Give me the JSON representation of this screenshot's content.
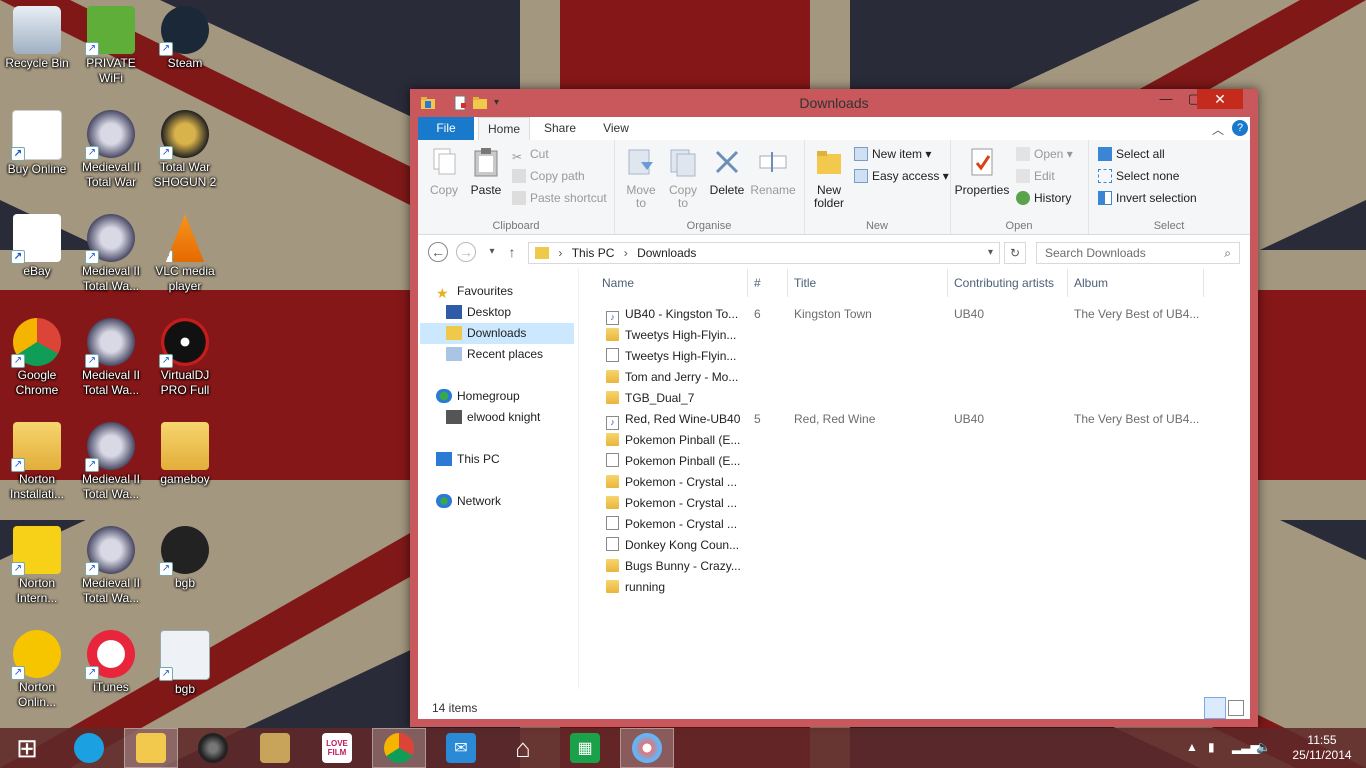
{
  "desktop": {
    "icons": [
      {
        "label": "Recycle Bin",
        "icon": "recycle-bin-icon"
      },
      {
        "label": "PRIVATE WiFi",
        "icon": "private-wifi-icon"
      },
      {
        "label": "Steam",
        "icon": "steam-icon"
      },
      {
        "label": "Buy Online",
        "icon": "acer-icon"
      },
      {
        "label": "Medieval II Total War",
        "icon": "medieval-helmet-icon"
      },
      {
        "label": "Total War SHOGUN 2",
        "icon": "shogun-helmet-icon"
      },
      {
        "label": "eBay",
        "icon": "ebay-icon"
      },
      {
        "label": "Medieval II Total Wa...",
        "icon": "medieval-helmet-icon"
      },
      {
        "label": "VLC media player",
        "icon": "vlc-cone-icon"
      },
      {
        "label": "Google Chrome",
        "icon": "chrome-icon"
      },
      {
        "label": "Medieval II Total Wa...",
        "icon": "medieval-helmet-icon"
      },
      {
        "label": "VirtualDJ PRO Full",
        "icon": "virtualdj-icon"
      },
      {
        "label": "Norton Installati...",
        "icon": "folder-icon"
      },
      {
        "label": "Medieval II Total Wa...",
        "icon": "medieval-helmet-icon"
      },
      {
        "label": "gameboy",
        "icon": "folder-icon"
      },
      {
        "label": "Norton Intern...",
        "icon": "norton-internet-icon"
      },
      {
        "label": "Medieval II Total Wa...",
        "icon": "medieval-helmet-icon"
      },
      {
        "label": "bgb",
        "icon": "gamepad-icon"
      },
      {
        "label": "Norton Onlin...",
        "icon": "norton-online-icon"
      },
      {
        "label": "iTunes",
        "icon": "itunes-icon"
      },
      {
        "label": "bgb",
        "icon": "config-file-icon"
      }
    ]
  },
  "window": {
    "title": "Downloads",
    "tabs": {
      "file": "File",
      "home": "Home",
      "share": "Share",
      "view": "View"
    },
    "ribbon": {
      "clipboard": {
        "name": "Clipboard",
        "copy": "Copy",
        "paste": "Paste",
        "cut": "Cut",
        "copy_path": "Copy path",
        "paste_shortcut": "Paste shortcut"
      },
      "organise": {
        "name": "Organise",
        "move_to": "Move to",
        "copy_to": "Copy to",
        "delete": "Delete",
        "rename": "Rename"
      },
      "new": {
        "name": "New",
        "new_folder": "New folder",
        "new_item": "New item",
        "easy_access": "Easy access"
      },
      "open": {
        "name": "Open",
        "properties": "Properties",
        "open": "Open",
        "edit": "Edit",
        "history": "History"
      },
      "select": {
        "name": "Select",
        "select_all": "Select all",
        "select_none": "Select none",
        "invert_selection": "Invert selection"
      }
    },
    "address": {
      "crumbs": [
        "This PC",
        "Downloads"
      ],
      "search_placeholder": "Search Downloads"
    },
    "nav": {
      "favourites": "Favourites",
      "desktop": "Desktop",
      "downloads": "Downloads",
      "recent": "Recent places",
      "homegroup": "Homegroup",
      "user": "elwood knight",
      "this_pc": "This PC",
      "network": "Network"
    },
    "columns": {
      "name": "Name",
      "num": "#",
      "title": "Title",
      "artists": "Contributing artists",
      "album": "Album"
    },
    "files": [
      {
        "name": "UB40 - Kingston To...",
        "type": "music",
        "num": "6",
        "title": "Kingston Town",
        "artist": "UB40",
        "album": "The Very Best of UB4..."
      },
      {
        "name": "Tweetys High-Flyin...",
        "type": "folder",
        "num": "",
        "title": "",
        "artist": "",
        "album": ""
      },
      {
        "name": "Tweetys High-Flyin...",
        "type": "doc",
        "num": "",
        "title": "",
        "artist": "",
        "album": ""
      },
      {
        "name": "Tom and Jerry - Mo...",
        "type": "folder",
        "num": "",
        "title": "",
        "artist": "",
        "album": ""
      },
      {
        "name": "TGB_Dual_7",
        "type": "folder",
        "num": "",
        "title": "",
        "artist": "",
        "album": ""
      },
      {
        "name": "Red, Red Wine-UB40",
        "type": "music",
        "num": "5",
        "title": "Red, Red Wine",
        "artist": "UB40",
        "album": "The Very Best of UB4..."
      },
      {
        "name": "Pokemon Pinball (E...",
        "type": "folder",
        "num": "",
        "title": "",
        "artist": "",
        "album": ""
      },
      {
        "name": "Pokemon Pinball (E...",
        "type": "doc",
        "num": "",
        "title": "",
        "artist": "",
        "album": ""
      },
      {
        "name": "Pokemon - Crystal ...",
        "type": "folder",
        "num": "",
        "title": "",
        "artist": "",
        "album": ""
      },
      {
        "name": "Pokemon - Crystal ...",
        "type": "folder",
        "num": "",
        "title": "",
        "artist": "",
        "album": ""
      },
      {
        "name": "Pokemon - Crystal ...",
        "type": "doc",
        "num": "",
        "title": "",
        "artist": "",
        "album": ""
      },
      {
        "name": "Donkey Kong Coun...",
        "type": "doc",
        "num": "",
        "title": "",
        "artist": "",
        "album": ""
      },
      {
        "name": "Bugs Bunny - Crazy...",
        "type": "folder",
        "num": "",
        "title": "",
        "artist": "",
        "album": ""
      },
      {
        "name": "running",
        "type": "folder",
        "num": "",
        "title": "",
        "artist": "",
        "album": ""
      }
    ],
    "status": "14 items"
  },
  "taskbar": {
    "apps": [
      "start-icon",
      "internet-explorer-icon",
      "file-explorer-icon",
      "speaker-app-icon",
      "vintage-app-icon",
      "lovefilm-icon",
      "chrome-icon",
      "mail-icon",
      "home-icon",
      "store-icon",
      "paint-icon"
    ],
    "lovefilm_label": "LOVE FILM",
    "clock_time": "11:55",
    "clock_date": "25/11/2014"
  },
  "colors": {
    "accent": "#1979ca",
    "window_frame": "#c8585b",
    "close": "#c42b1c"
  }
}
